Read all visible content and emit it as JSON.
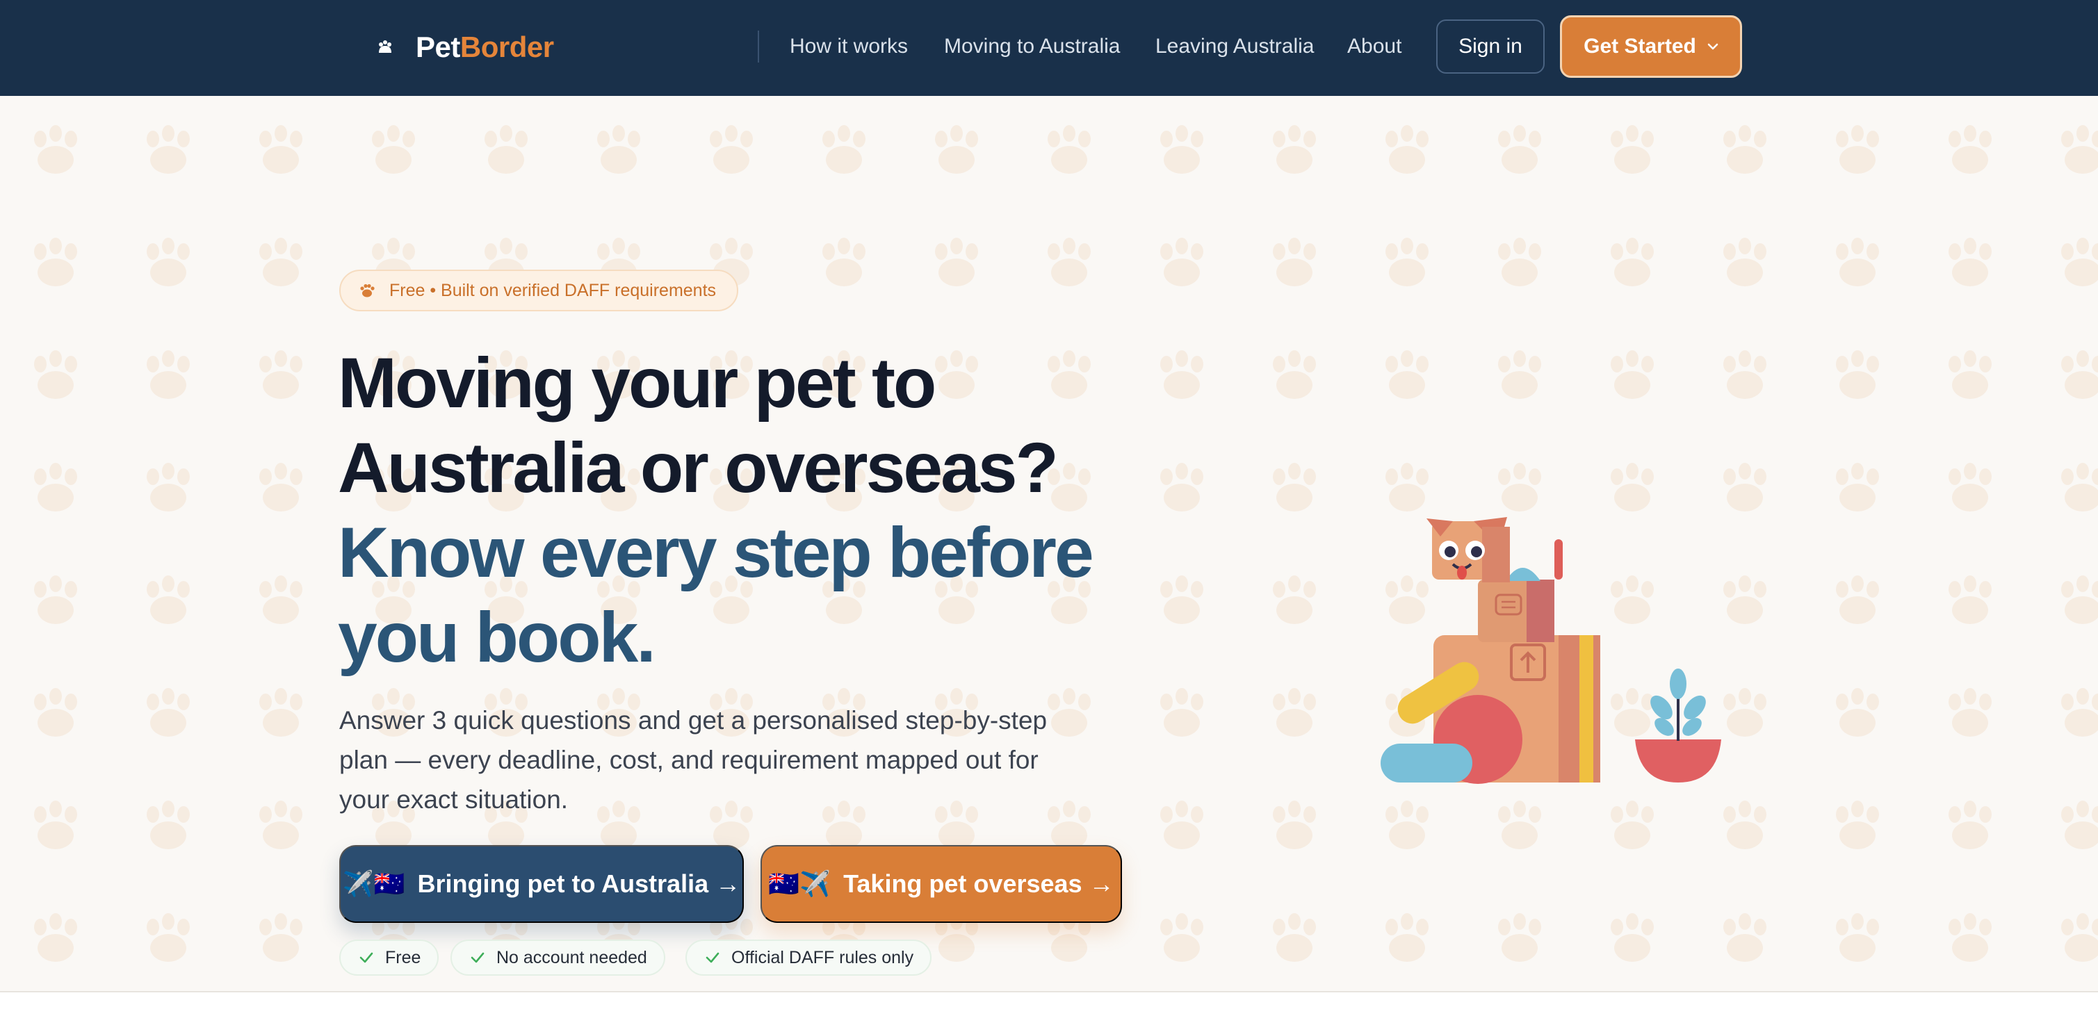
{
  "nav": {
    "logo_part1": "Pet",
    "logo_part2": "Border",
    "logo_icon": "paw-icon",
    "links": [
      "How it works",
      "Moving to Australia",
      "Leaving Australia",
      "About"
    ],
    "signin_label": "Sign in",
    "get_started_label": "Get Started",
    "get_started_icon": "chevron-down-icon"
  },
  "hero": {
    "badge_icon": "paw-icon",
    "badge_text": "Free • Built on verified DAFF requirements",
    "headline_line1": "Moving your pet to",
    "headline_line2": "Australia or overseas?",
    "headline_line3": "Know every step before",
    "headline_line4": "you book.",
    "subtext": "Answer 3 quick questions and get a personalised step-by-step plan — every deadline, cost, and requirement mapped out for your exact situation.",
    "cta_australia": "Bringing pet to Australia →",
    "cta_australia_icons": "✈️🇦🇺",
    "cta_overseas": "Taking pet overseas →",
    "cta_overseas_icons": "🇦🇺✈️",
    "checks": [
      "Free",
      "No account needed",
      "Official DAFF rules only"
    ],
    "check_icon": "check-icon",
    "illustration": "pet-in-moving-boxes-illustration"
  },
  "colors": {
    "nav_bg": "#19304a",
    "accent_orange": "#d97e37",
    "navy_blue": "#2b4d70",
    "headline_dark": "#141b2b",
    "headline_blue": "#2b5577",
    "check_green": "#3fae5a",
    "page_bg": "#faf8f5"
  }
}
